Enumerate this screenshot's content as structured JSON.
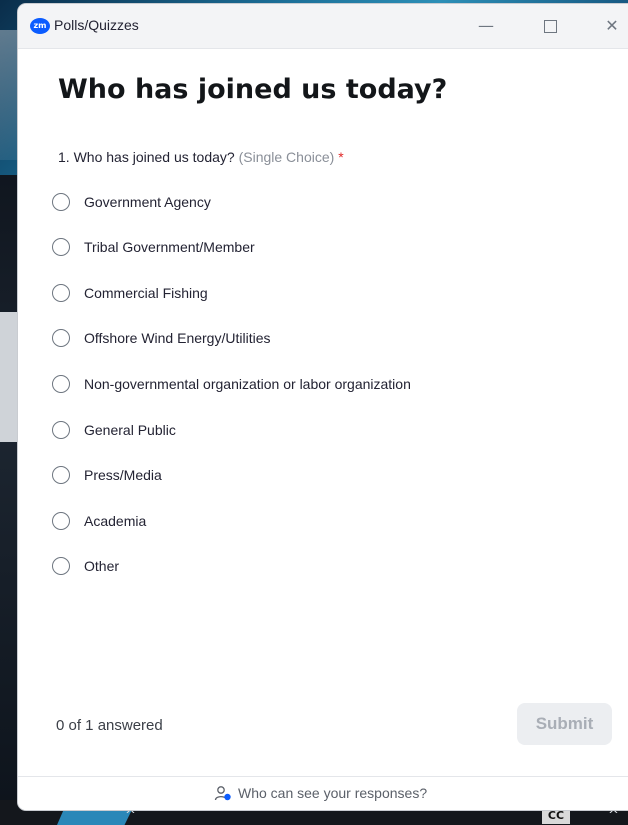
{
  "window": {
    "title": "Polls/Quizzes",
    "logo_text": "zm"
  },
  "poll": {
    "title": "Who has joined us today?",
    "question_number": "1.",
    "question_text": "Who has joined us today?",
    "question_type": "(Single Choice)",
    "required_mark": "*",
    "options": [
      "Government Agency",
      "Tribal Government/Member",
      "Commercial Fishing",
      "Offshore Wind Energy/Utilities",
      "Non-governmental organization or labor organization",
      "General Public",
      "Press/Media",
      "Academia",
      "Other"
    ]
  },
  "footer": {
    "progress": "0 of 1 answered",
    "submit_label": "Submit",
    "privacy_link": "Who can see your responses?"
  },
  "taskbar": {
    "cc_label": "CC"
  },
  "colors": {
    "accent": "#0b5cff",
    "required": "#e02828",
    "submit_disabled_bg": "#eceef1"
  }
}
